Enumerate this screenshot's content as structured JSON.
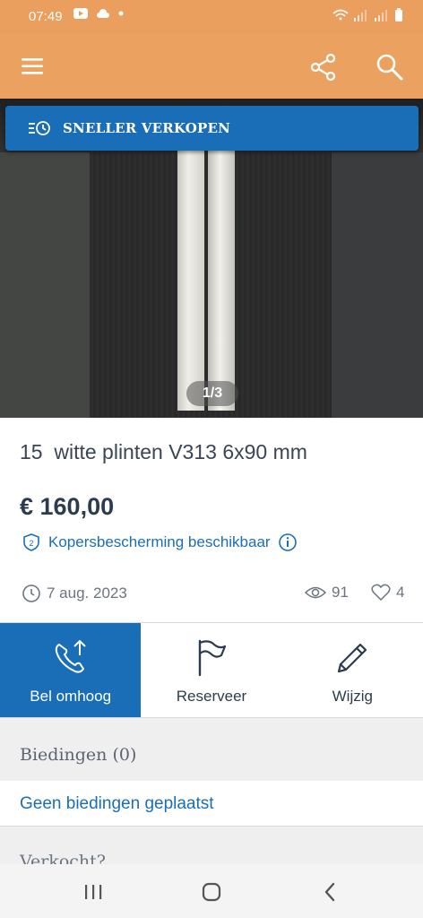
{
  "status": {
    "time": "07:49"
  },
  "topbar": {
    "menu_icon": "menu-icon",
    "share_icon": "share-icon",
    "search_icon": "search-icon"
  },
  "banner": {
    "label": "SNELLER VERKOPEN"
  },
  "gallery": {
    "pager": "1/3"
  },
  "listing": {
    "title": "15  witte plinten V313 6x90 mm",
    "price": "€ 160,00",
    "protection": "Kopersbescherming beschikbaar",
    "date": "7 aug. 2023",
    "views": "91",
    "favorites": "4"
  },
  "actions": [
    {
      "label": "Bel omhoog"
    },
    {
      "label": "Reserveer"
    },
    {
      "label": "Wijzig"
    }
  ],
  "bids": {
    "heading": "Biedingen (0)",
    "empty": "Geen biedingen geplaatst"
  },
  "sold": {
    "label": "Verkocht?"
  },
  "colors": {
    "accent": "#1a6eb8",
    "header": "#eba15f"
  }
}
